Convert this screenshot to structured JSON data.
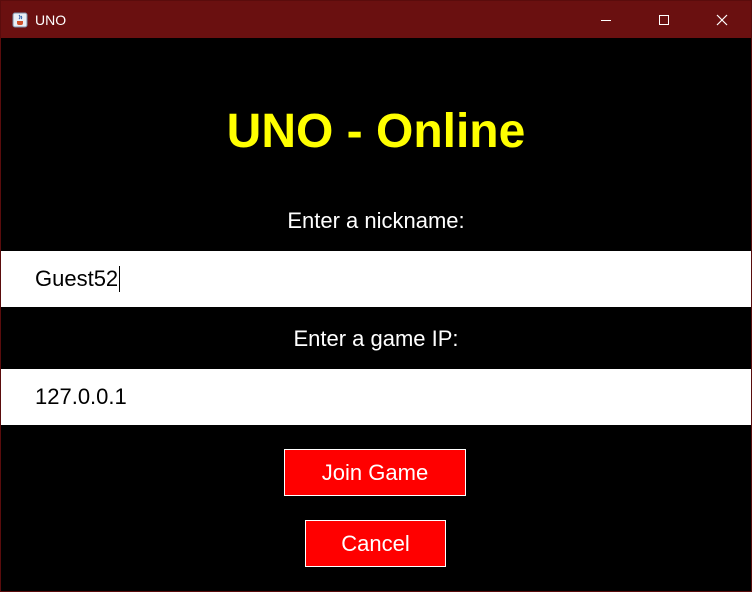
{
  "window": {
    "title": "UNO",
    "icon": "java-cup-icon",
    "controls": [
      "minimize-icon",
      "maximize-icon",
      "close-icon"
    ]
  },
  "main": {
    "heading": "UNO - Online",
    "nickname_label": "Enter a nickname:",
    "nickname_value": "Guest52",
    "ip_label": "Enter a game IP:",
    "ip_value": "127.0.0.1",
    "join_button": "Join Game",
    "cancel_button": "Cancel"
  },
  "colors": {
    "titlebar": "#6a1010",
    "background": "#000000",
    "heading": "#ffff00",
    "button": "#ff0000",
    "text": "#ffffff"
  }
}
